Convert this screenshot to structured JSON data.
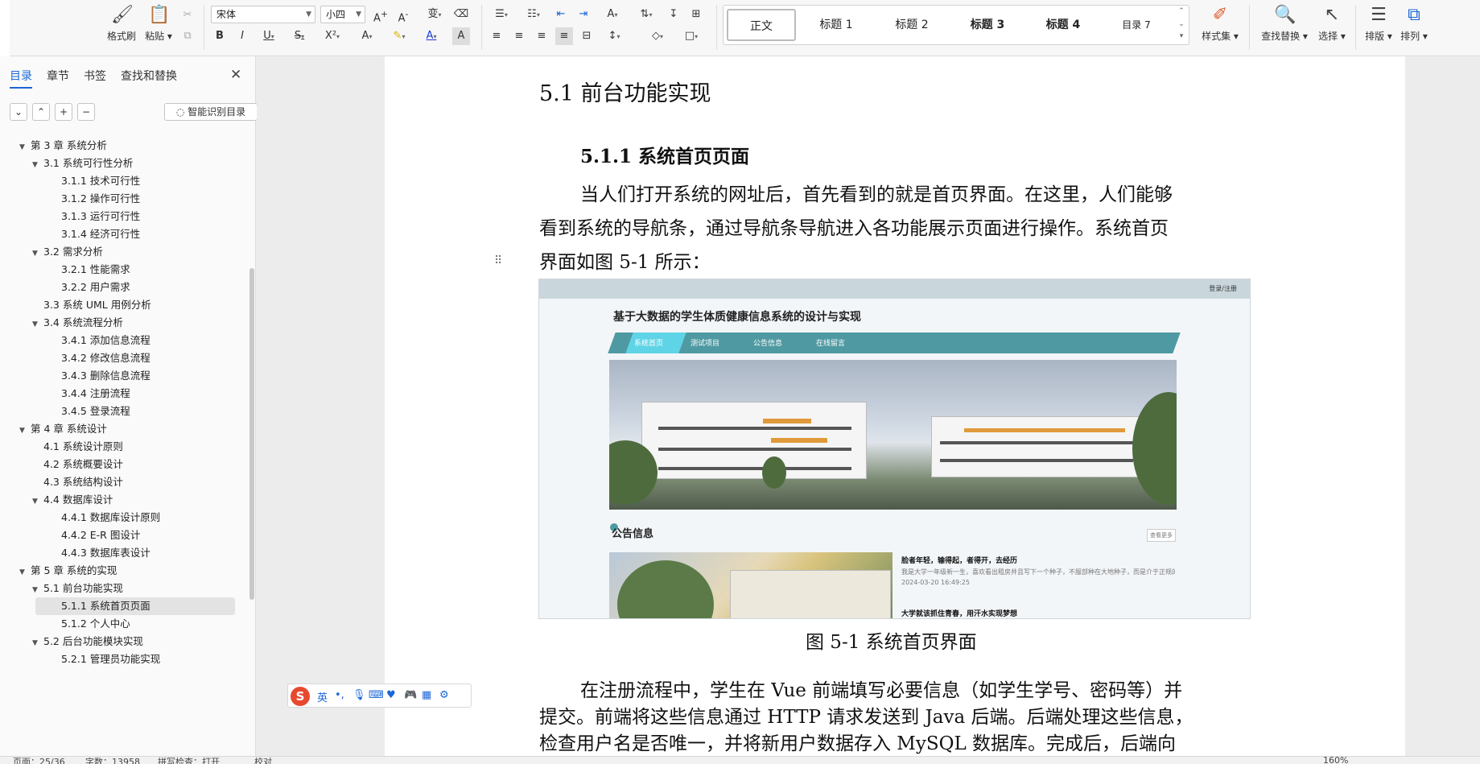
{
  "ribbon": {
    "format_painter": "格式刷",
    "paste": "粘贴",
    "font_name": "宋体",
    "font_size": "小四",
    "styles": [
      "正文",
      "标题 1",
      "标题 2",
      "标题 3",
      "标题 4",
      "目录 7"
    ],
    "style_set": "样式集",
    "find_replace": "查找替换",
    "select": "选择",
    "layout": "排版",
    "arrange": "排列"
  },
  "sidebar": {
    "tabs": [
      "目录",
      "章节",
      "书签",
      "查找和替换"
    ],
    "smart_toc": "智能识别目录",
    "toc": [
      {
        "label": "第 3 章  系统分析",
        "level": 0,
        "expanded": true
      },
      {
        "label": "3.1  系统可行性分析",
        "level": 1,
        "expanded": true
      },
      {
        "label": "3.1.1  技术可行性",
        "level": 2
      },
      {
        "label": "3.1.2  操作可行性",
        "level": 2
      },
      {
        "label": "3.1.3  运行可行性",
        "level": 2
      },
      {
        "label": "3.1.4  经济可行性",
        "level": 2
      },
      {
        "label": "3.2  需求分析",
        "level": 1,
        "expanded": true
      },
      {
        "label": "3.2.1  性能需求",
        "level": 2
      },
      {
        "label": "3.2.2  用户需求",
        "level": 2
      },
      {
        "label": "3.3  系统 UML 用例分析",
        "level": 1
      },
      {
        "label": "3.4  系统流程分析",
        "level": 1,
        "expanded": true
      },
      {
        "label": "3.4.1  添加信息流程",
        "level": 2
      },
      {
        "label": "3.4.2  修改信息流程",
        "level": 2
      },
      {
        "label": "3.4.3  删除信息流程",
        "level": 2
      },
      {
        "label": "3.4.4  注册流程",
        "level": 2
      },
      {
        "label": "3.4.5  登录流程",
        "level": 2
      },
      {
        "label": "第 4 章  系统设计",
        "level": 0,
        "expanded": true
      },
      {
        "label": "4.1  系统设计原则",
        "level": 1
      },
      {
        "label": "4.2  系统概要设计",
        "level": 1
      },
      {
        "label": "4.3  系统结构设计",
        "level": 1
      },
      {
        "label": "4.4  数据库设计",
        "level": 1,
        "expanded": true
      },
      {
        "label": "4.4.1  数据库设计原则",
        "level": 2
      },
      {
        "label": "4.4.2  E-R 图设计",
        "level": 2
      },
      {
        "label": "4.4.3  数据库表设计",
        "level": 2
      },
      {
        "label": "第 5 章  系统的实现",
        "level": 0,
        "expanded": true
      },
      {
        "label": "5.1  前台功能实现",
        "level": 1,
        "expanded": true
      },
      {
        "label": "5.1.1  系统首页页面",
        "level": 2,
        "selected": true
      },
      {
        "label": "5.1.2  个人中心",
        "level": 2
      },
      {
        "label": "5.2  后台功能模块实现",
        "level": 1,
        "expanded": true
      },
      {
        "label": "5.2.1  管理员功能实现",
        "level": 2
      }
    ]
  },
  "doc": {
    "heading2": "5.1  前台功能实现",
    "heading3": "5.1.1  系统首页页面",
    "para1": [
      "当人们打开系统的网址后，首先看到的就是首页界面。在这里，人们能够",
      "看到系统的导航条，通过导航条导航进入各功能展示页面进行操作。系统首页",
      "界面如图 5-1 所示："
    ],
    "figure": {
      "login": "登录/注册",
      "title": "基于大数据的学生体质健康信息系统的设计与实现",
      "nav": [
        "系统首页",
        "测试项目",
        "公告信息",
        "在线留言"
      ],
      "section": "公告信息",
      "more": "查看更多",
      "news_title": "脸者年轻，输得起，者得开，去经历",
      "news_summary": "我是大学一年级新一生，喜欢看出租房并且写下一个种子，不服部种在大地种子，而是介于正规的塑料树脂种之间的编结体系，比较养体量覆了15斤。",
      "news_meta": "2024-03-20 16:49:25",
      "news2_title": "大学就该抓住青春，用汗水实现梦想"
    },
    "caption": "图 5-1 系统首页界面",
    "para2": [
      "在注册流程中，学生在 Vue 前端填写必要信息（如学生学号、密码等）并",
      "提交。前端将这些信息通过 HTTP 请求发送到 Java 后端。后端处理这些信息，",
      "检查用户名是否唯一，并将新用户数据存入 MySQL 数据库。完成后，后端向"
    ]
  },
  "ime": {
    "mode": "英"
  },
  "status": {
    "page": "页面：25/36",
    "words": "字数：13958",
    "spell": "拼写检查：打开",
    "proof": "校对",
    "zoom": "160%"
  }
}
